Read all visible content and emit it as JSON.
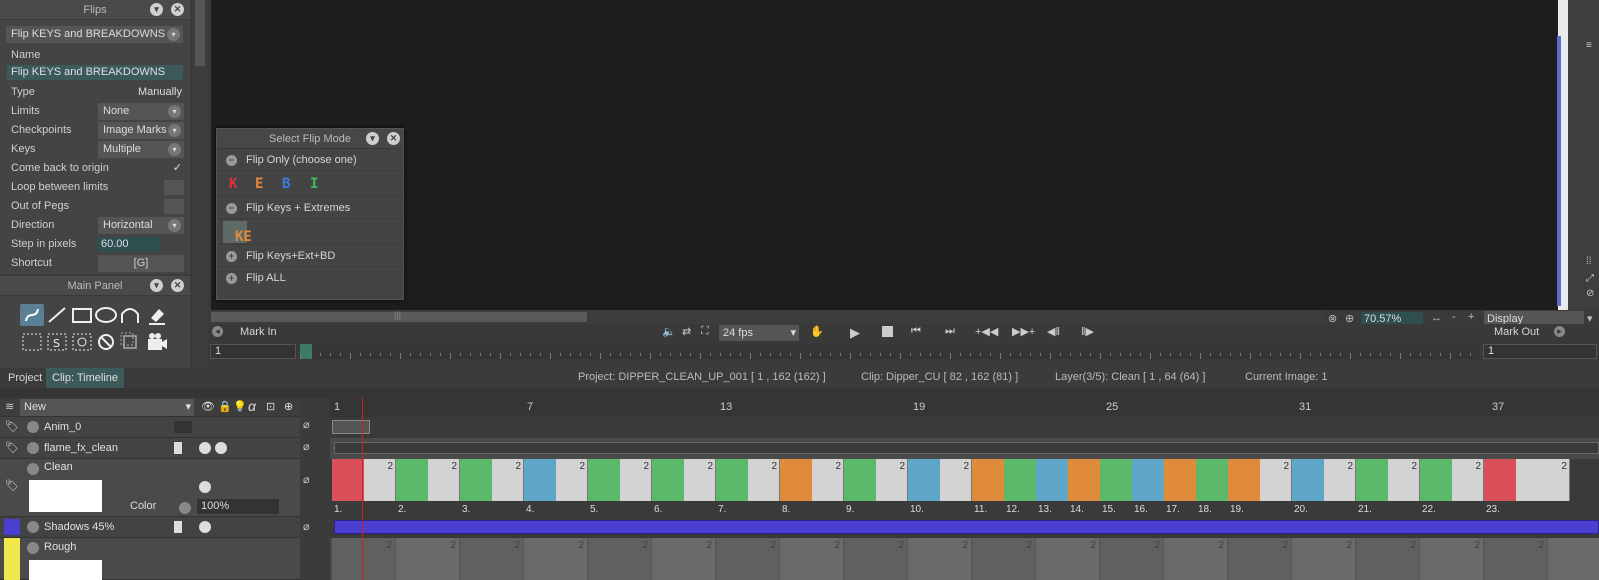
{
  "flips_panel": {
    "title": "Flips",
    "preset": "Flip KEYS and BREAKDOWNS",
    "name_label": "Name",
    "name_value": "Flip KEYS and BREAKDOWNS",
    "rows": [
      {
        "label": "Type",
        "value": "Manually"
      },
      {
        "label": "Limits",
        "value": "None"
      },
      {
        "label": "Checkpoints",
        "value": "Image Marks"
      },
      {
        "label": "Keys",
        "value": "Multiple"
      },
      {
        "label": "Come back to origin",
        "value": "✓"
      },
      {
        "label": "Loop between limits",
        "value": ""
      },
      {
        "label": "Out of Pegs",
        "value": ""
      },
      {
        "label": "Direction",
        "value": "Horizontal"
      },
      {
        "label": "Step in pixels",
        "value": "60.00"
      },
      {
        "label": "Shortcut",
        "value": "[G]"
      }
    ]
  },
  "main_panel": {
    "title": "Main Panel"
  },
  "popup": {
    "title": "Select Flip Mode",
    "flip_only": "Flip Only (choose one)",
    "letters": [
      "K",
      "E",
      "B",
      "I"
    ],
    "flip_keys_extremes": "Flip Keys + Extremes",
    "ke_label": "KE",
    "flip_keys_ext_bd": "Flip Keys+Ext+BD",
    "flip_all": "Flip ALL"
  },
  "viewer": {
    "zoom": "70.57%",
    "display": "Display"
  },
  "transport": {
    "mark_in": "Mark In",
    "mark_out": "Mark Out",
    "fps": "24 fps",
    "mark_in_value": "1",
    "mark_out_value": "1"
  },
  "tabs": {
    "project": "Project",
    "clip_timeline": "Clip: Timeline"
  },
  "info": {
    "project": "Project: DIPPER_CLEAN_UP_001 [ 1 , 162  (162) ]",
    "clip": "Clip: Dipper_CU [ 82 , 162  (81) ]",
    "layer": "Layer(3/5): Clean [ 1 , 64  (64) ]",
    "current": "Current Image: 1"
  },
  "layers": {
    "new_label": "New",
    "items": [
      {
        "name": "Anim_0"
      },
      {
        "name": "flame_fx_clean"
      },
      {
        "name": "Clean"
      },
      {
        "name": "Shadows 45%"
      },
      {
        "name": "Rough"
      }
    ],
    "color_label": "Color",
    "opacity": "100%"
  },
  "timeline": {
    "ticks": [
      "1",
      "7",
      "13",
      "19",
      "25",
      "31",
      "37"
    ],
    "frame_numbers": [
      "1.",
      "2.",
      "3.",
      "4.",
      "5.",
      "6.",
      "7.",
      "8.",
      "9.",
      "10.",
      "11.",
      "12.",
      "13.",
      "14.",
      "15.",
      "16.",
      "17.",
      "18.",
      "19.",
      "20.",
      "21.",
      "22.",
      "23."
    ],
    "hold": "2"
  },
  "colors": {
    "key": "#d9505a",
    "extreme": "#e08a3c",
    "breakdown": "#5fa6c8",
    "inbetween": "#5cb86b",
    "shadow": "#4a3fd0"
  }
}
